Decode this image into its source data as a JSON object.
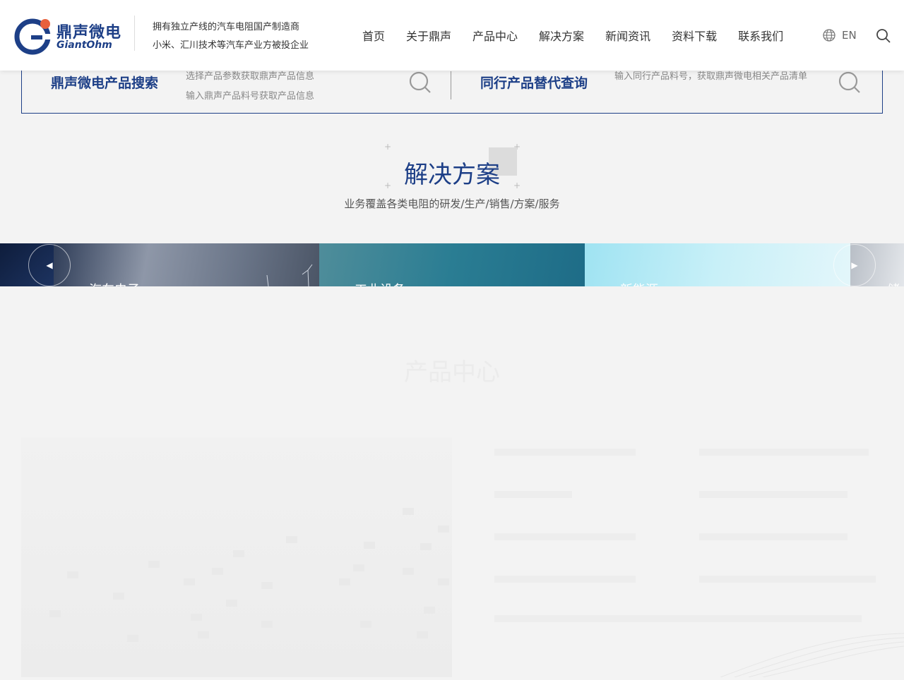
{
  "header": {
    "logo_cn": "鼎声微电",
    "logo_en": "GiantOhm",
    "tagline_1": "拥有独立产线的汽车电阻国产制造商",
    "tagline_2": "小米、汇川技术等汽车产业方被投企业",
    "nav": [
      "首页",
      "关于鼎声",
      "产品中心",
      "解决方案",
      "新闻资讯",
      "资料下载",
      "联系我们"
    ],
    "lang_label": "EN"
  },
  "search_bar": {
    "left_title": "鼎声微电产品搜索",
    "left_hint_1": "选择产品参数获取鼎声产品信息",
    "left_hint_2": "输入鼎声产品料号获取产品信息",
    "right_title": "同行产品替代查询",
    "right_hint": "输入同行产品料号，获取鼎声微电相关产品清单"
  },
  "solutions": {
    "title": "解决方案",
    "subtitle": "业务覆盖各类电阻的研发/生产/销售/方案/服务",
    "panels": [
      "汽车电子",
      "工业设备",
      "新能源",
      "储"
    ]
  },
  "products": {
    "title": "产品中心"
  },
  "colors": {
    "brand": "#1d3f87",
    "accent_orange": "#e8603c"
  }
}
